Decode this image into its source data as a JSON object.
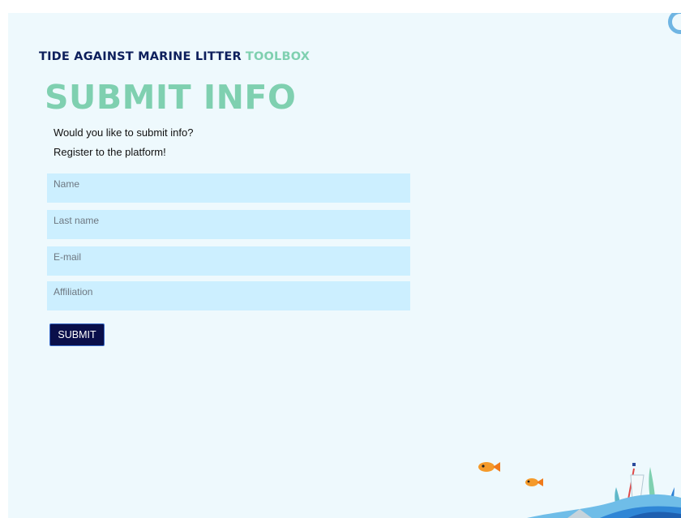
{
  "brand": {
    "primary": "TIDE AGAINST MARINE LITTER",
    "accent": "TOOLBOX"
  },
  "heading": "SUBMIT INFO",
  "intro": [
    "Would you like to submit info?",
    "Register to the platform!"
  ],
  "form": {
    "fields": [
      {
        "placeholder": "Name"
      },
      {
        "placeholder": "Last name"
      },
      {
        "placeholder": "E-mail"
      },
      {
        "placeholder": "Affiliation"
      }
    ],
    "submit_label": "SUBMIT"
  },
  "colors": {
    "background": "#eef9fd",
    "brand_dark": "#0d1f5c",
    "accent_green": "#7fd0b0",
    "field_bg": "#ccefff",
    "button_bg": "#0a0f4a"
  },
  "decorations": [
    "fish-icon",
    "fish-icon",
    "seaweed-icon",
    "wave-icon"
  ]
}
